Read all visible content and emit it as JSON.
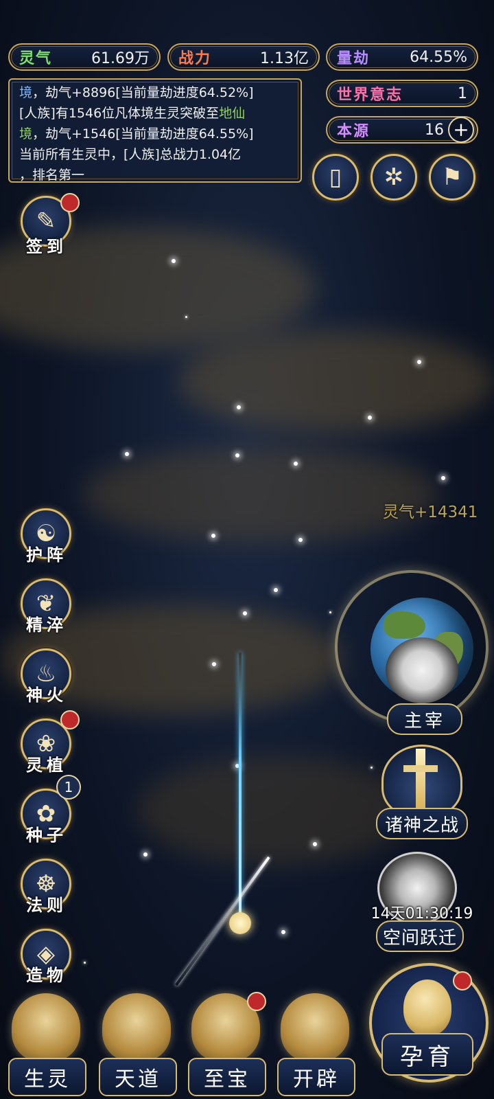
{
  "stats": {
    "lingqi": {
      "label": "灵气",
      "value": "61.69万",
      "color": "#7ee26a"
    },
    "zhanli": {
      "label": "战力",
      "value": "1.13亿",
      "color": "#ff7a4a"
    },
    "liangjie": {
      "label": "量劫",
      "value": "64.55%",
      "color": "#b78cff"
    },
    "shijie": {
      "label": "世界意志",
      "value": "1",
      "color": "#ff6fa8"
    },
    "benyuan": {
      "label": "本源",
      "value": "16",
      "color": "#d58cff"
    }
  },
  "log": {
    "line1_prefix": "境",
    "line1_rest": "，劫气+8896[当前量劫进度64.52%]",
    "line2_pre": "[人族]有1546位凡体境生灵突破至",
    "line2_hl": "地仙",
    "line3_hl": "境",
    "line3_rest": "，劫气+1546[当前量劫进度64.55%]",
    "line4": "当前所有生灵中，[人族]总战力1.04亿",
    "line5": "，排名第一"
  },
  "left_menu": [
    {
      "label": "签到",
      "icon": "brush-scroll-icon",
      "glyph": "✎"
    },
    {
      "label": "护阵",
      "icon": "yin-yang-icon",
      "glyph": "☯"
    },
    {
      "label": "精淬",
      "icon": "lotus-flame-icon",
      "glyph": "❦"
    },
    {
      "label": "神火",
      "icon": "fire-icon",
      "glyph": "♨"
    },
    {
      "label": "灵植",
      "icon": "plant-icon",
      "glyph": "❀"
    },
    {
      "label": "种子",
      "icon": "seed-icon",
      "glyph": "✿",
      "count": "1"
    },
    {
      "label": "法则",
      "icon": "rule-icon",
      "glyph": "☸"
    },
    {
      "label": "造物",
      "icon": "creation-icon",
      "glyph": "◈"
    }
  ],
  "right_menu": {
    "zhuzai": "主宰",
    "zhushen": "诸神之战",
    "kongjian": "空间跃迁",
    "timer": "14天01:30:19"
  },
  "bottom_nav": [
    {
      "label": "生灵",
      "icon": "phoenix-icon"
    },
    {
      "label": "天道",
      "icon": "swirl-icon"
    },
    {
      "label": "至宝",
      "icon": "treasure-icon"
    },
    {
      "label": "开辟",
      "icon": "axe-icon"
    }
  ],
  "main_action": {
    "label": "孕育",
    "icon": "embryo-icon"
  },
  "floating": {
    "gain": "灵气+14341"
  }
}
